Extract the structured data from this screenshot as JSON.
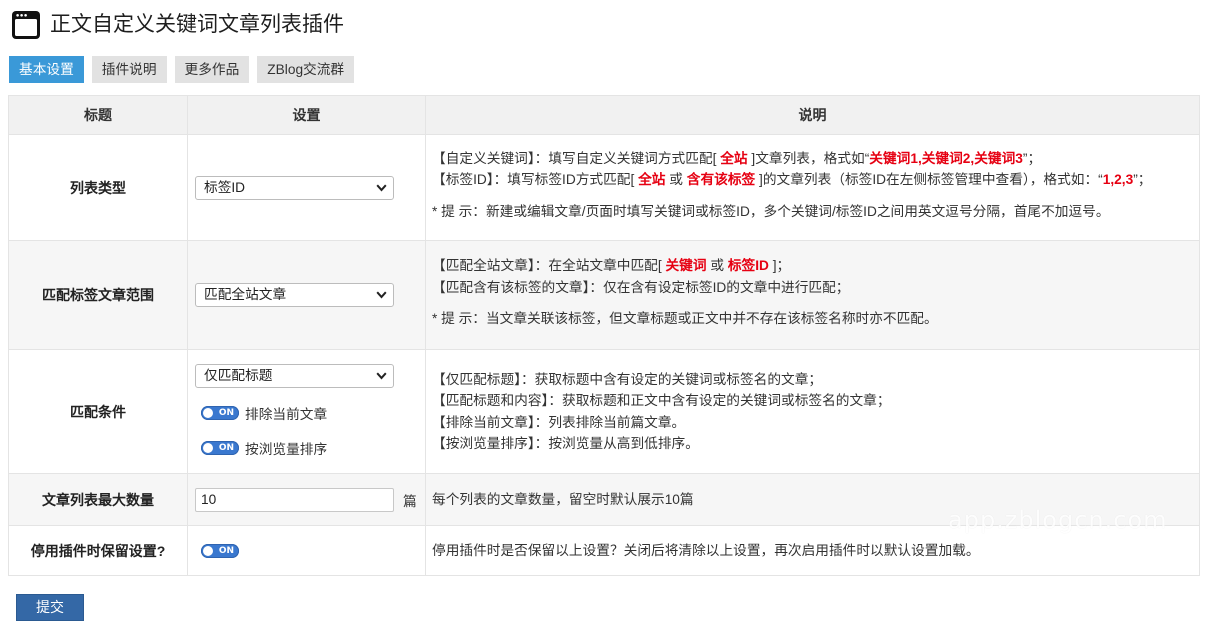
{
  "app": {
    "title": "正文自定义关键词文章列表插件",
    "icon": "window-icon"
  },
  "tabs": [
    {
      "label": "基本设置",
      "active": true
    },
    {
      "label": "插件说明",
      "active": false
    },
    {
      "label": "更多作品",
      "active": false
    },
    {
      "label": "ZBlog交流群",
      "active": false
    }
  ],
  "table": {
    "headers": [
      "标题",
      "设置",
      "说明"
    ],
    "rows": [
      {
        "label": "列表类型",
        "select": "标签ID",
        "desc": [
          [
            {
              "text": "【自定义关键词】：填写自定义关键词方式匹配[ "
            },
            {
              "text": "全站",
              "hl": true
            },
            {
              "text": " ]文章列表，格式如“"
            },
            {
              "text": "关键词1,关键词2,关键词3",
              "hl": true
            },
            {
              "text": "”；"
            }
          ],
          [
            {
              "text": "【标签ID】：填写标签ID方式匹配[ "
            },
            {
              "text": "全站",
              "hl": true
            },
            {
              "text": " 或 "
            },
            {
              "text": "含有该标签",
              "hl": true
            },
            {
              "text": " ]的文章列表（标签ID在左侧标签管理中查看），格式如：“"
            },
            {
              "text": "1,2,3",
              "hl": true
            },
            {
              "text": "”；"
            }
          ]
        ],
        "hint": "* 提 示：新建或编辑文章/页面时填写关键词或标签ID，多个关键词/标签ID之间用英文逗号分隔，首尾不加逗号。"
      },
      {
        "label": "匹配标签文章范围",
        "select": "匹配全站文章",
        "desc": [
          [
            {
              "text": "【匹配全站文章】：在全站文章中匹配[ "
            },
            {
              "text": "关键词",
              "hl": true
            },
            {
              "text": " 或 "
            },
            {
              "text": "标签ID",
              "hl": true
            },
            {
              "text": " ]；"
            }
          ],
          "【匹配含有该标签的文章】：仅在含有设定标签ID的文章中进行匹配；"
        ],
        "hint": "* 提 示：当文章关联该标签，但文章标题或正文中并不存在该标签名称时亦不匹配。"
      },
      {
        "label": "匹配条件",
        "select": "仅匹配标题",
        "toggles": [
          {
            "state": "ON",
            "label": "排除当前文章"
          },
          {
            "state": "ON",
            "label": "按浏览量排序"
          }
        ],
        "desc": [
          "【仅匹配标题】：获取标题中含有设定的关键词或标签名的文章；",
          "【匹配标题和内容】：获取标题和正文中含有设定的关键词或标签名的文章；",
          "【排除当前文章】：列表排除当前篇文章。",
          "【按浏览量排序】：按浏览量从高到低排序。"
        ]
      },
      {
        "label": "文章列表最大数量",
        "input": {
          "value": "10",
          "unit": "篇"
        },
        "desc": "每个列表的文章数量，留空时默认展示10篇"
      },
      {
        "label": "停用插件时保留设置?",
        "toggle": {
          "state": "ON"
        },
        "desc": "停用插件时是否保留以上设置？关闭后将清除以上设置，再次启用插件时以默认设置加载。"
      }
    ]
  },
  "submit": {
    "label": "提交"
  },
  "watermark": "app.zblogcn.com",
  "icons": {
    "app": "window-icon",
    "select_arrow": "chevron-down-icon"
  },
  "colors": {
    "accent": "#3a99d8",
    "highlight": "#e60012",
    "toggle_on": "#3a78cf",
    "submit": "#3468a6"
  }
}
